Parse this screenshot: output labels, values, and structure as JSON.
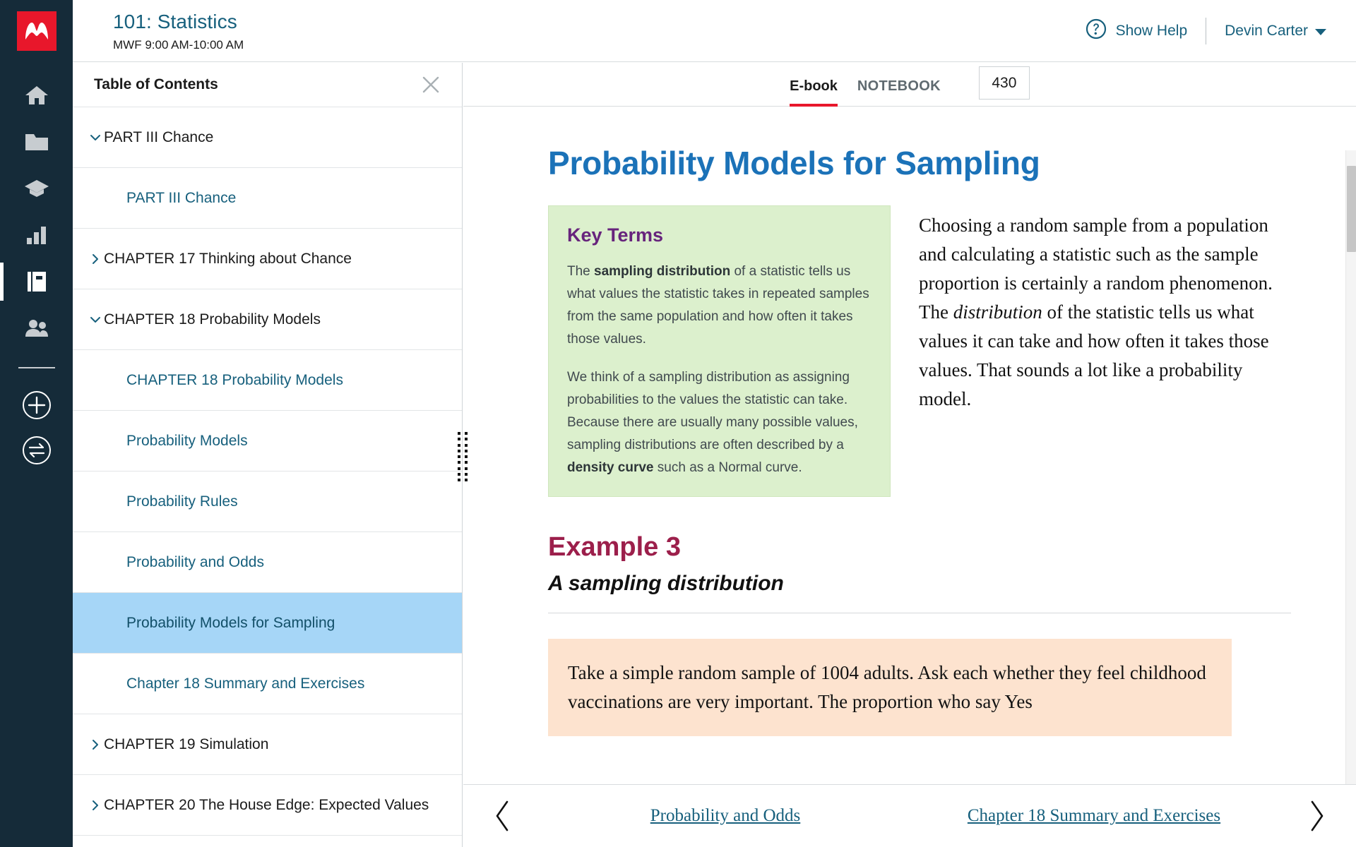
{
  "brand": {
    "logo_icon": "macmillan-m-logo",
    "accent": "#e8172b",
    "rail_bg": "#152b39"
  },
  "header": {
    "course_title": "101: Statistics",
    "course_meta": "MWF 9:00 AM-10:00 AM",
    "help_label": "Show Help",
    "help_icon": "question-circle-icon",
    "user_name": "Devin Carter",
    "user_caret_icon": "chevron-down-icon"
  },
  "rail": {
    "items": [
      {
        "name": "home",
        "icon": "home-icon",
        "active": false
      },
      {
        "name": "folder",
        "icon": "folder-icon",
        "active": false
      },
      {
        "name": "courses",
        "icon": "graduation-cap-icon",
        "active": false
      },
      {
        "name": "gradebook",
        "icon": "bar-chart-icon",
        "active": false
      },
      {
        "name": "ebook",
        "icon": "book-icon",
        "active": true
      },
      {
        "name": "people",
        "icon": "people-icon",
        "active": false
      }
    ],
    "actions": [
      {
        "name": "add",
        "icon": "plus-circle-icon"
      },
      {
        "name": "switch",
        "icon": "swap-circle-icon"
      }
    ]
  },
  "toc": {
    "title": "Table of Contents",
    "close_icon": "close-icon",
    "items": [
      {
        "label": "PART III Chance",
        "level": 1,
        "chevron": "chevron-down-icon",
        "selected": false
      },
      {
        "label": "PART III Chance",
        "level": 2,
        "chevron": null,
        "selected": false
      },
      {
        "label": "CHAPTER 17 Thinking about Chance",
        "level": 1,
        "chevron": "chevron-right-icon",
        "selected": false
      },
      {
        "label": "CHAPTER 18 Probability Models",
        "level": 1,
        "chevron": "chevron-down-icon",
        "selected": false
      },
      {
        "label": "CHAPTER 18 Probability Models",
        "level": 2,
        "chevron": null,
        "selected": false
      },
      {
        "label": "Probability Models",
        "level": 2,
        "chevron": null,
        "selected": false
      },
      {
        "label": "Probability Rules",
        "level": 2,
        "chevron": null,
        "selected": false
      },
      {
        "label": "Probability and Odds",
        "level": 2,
        "chevron": null,
        "selected": false
      },
      {
        "label": "Probability Models for Sampling",
        "level": 2,
        "chevron": null,
        "selected": true
      },
      {
        "label": "Chapter 18 Summary and Exercises",
        "level": 2,
        "chevron": null,
        "selected": false
      },
      {
        "label": "CHAPTER 19 Simulation",
        "level": 1,
        "chevron": "chevron-right-icon",
        "selected": false
      },
      {
        "label": "CHAPTER 20 The House Edge: Expected Values",
        "level": 1,
        "chevron": "chevron-right-icon",
        "selected": false
      }
    ],
    "selected_bg": "#a6d6f7",
    "drag_handle_icon": "drag-dots-icon"
  },
  "tabs": {
    "items": [
      {
        "label": "E-book",
        "active": true
      },
      {
        "label": "NOTEBOOK",
        "active": false
      }
    ],
    "active_underline": "#e8172b",
    "page_number": "430"
  },
  "doc": {
    "title": "Probability Models for Sampling",
    "title_color": "#1b72b8",
    "key_terms": {
      "heading": "Key Terms",
      "heading_color": "#67247c",
      "bg": "#dcf0cd",
      "paragraphs": [
        {
          "parts": [
            {
              "t": "The ",
              "b": false
            },
            {
              "t": "sampling distribution",
              "b": true
            },
            {
              "t": " of a statistic tells us what values the statistic takes in repeated samples from the same population and how often it takes those values.",
              "b": false
            }
          ]
        },
        {
          "parts": [
            {
              "t": "We think of a sampling distribution as assigning probabilities to the values the statistic can take. Because there are usually many possible values, sampling distributions are often described by a ",
              "b": false
            },
            {
              "t": "density curve",
              "b": true
            },
            {
              "t": " such as a Normal curve.",
              "b": false
            }
          ]
        }
      ]
    },
    "body_paragraph": {
      "parts": [
        {
          "t": "Choosing a random sample from a population and calculating a statistic such as the sample proportion is certainly a random phenomenon. The ",
          "i": false
        },
        {
          "t": "distribution",
          "i": true
        },
        {
          "t": " of the statistic tells us what values it can take and how often it takes those values. That sounds a lot like a probability model.",
          "i": false
        }
      ]
    },
    "example": {
      "heading": "Example 3",
      "heading_color": "#9c1f4b",
      "subheading": "A sampling distribution",
      "callout_bg": "#fde3cf",
      "callout_text": "Take a simple random sample of 1004 adults. Ask each whether they feel childhood vaccinations are very important. The proportion who say Yes"
    }
  },
  "bottom_nav": {
    "prev_icon": "chevron-left-icon",
    "prev_label": "Probability and Odds",
    "next_label": "Chapter 18 Summary and Exercises",
    "next_icon": "chevron-right-icon"
  }
}
